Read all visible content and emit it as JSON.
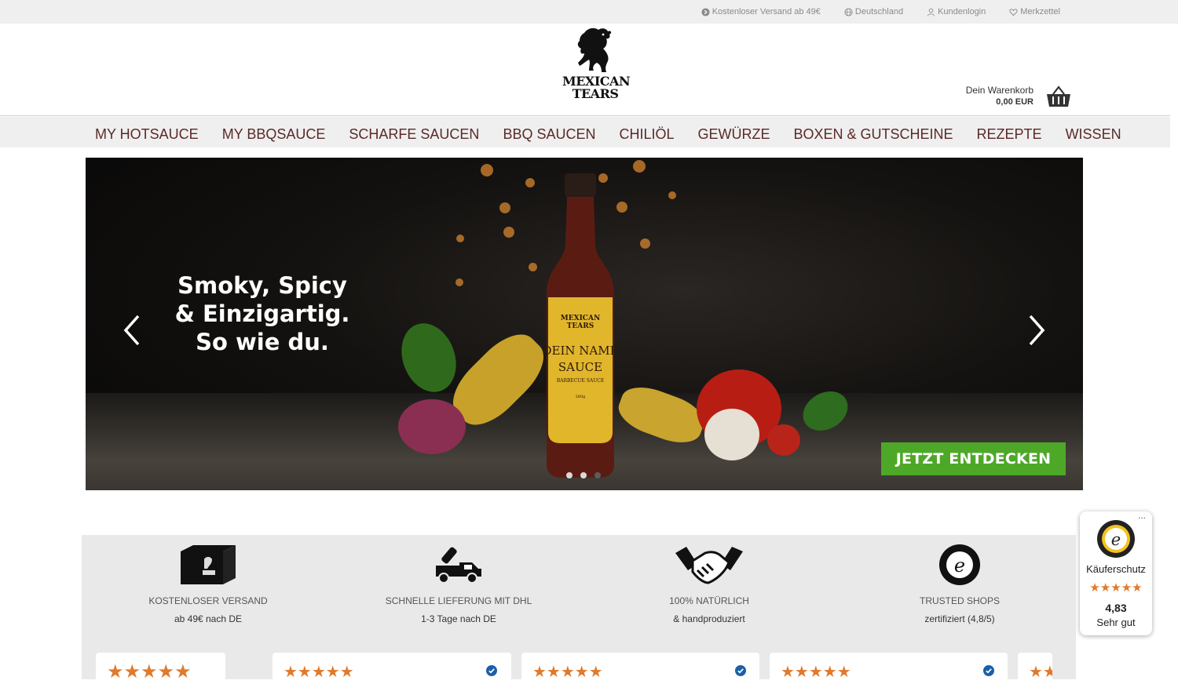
{
  "topbar": {
    "shipping": "Kostenloser Versand ab 49€",
    "country": "Deutschland",
    "login": "Kundenlogin",
    "wishlist": "Merkzettel"
  },
  "header": {
    "logo_line1": "MEXICAN",
    "logo_line2": "TEARS",
    "cart_label": "Dein Warenkorb",
    "cart_amount": "0,00 EUR"
  },
  "nav": {
    "items": [
      {
        "label": "MY HOTSAUCE"
      },
      {
        "label": "MY BBQSAUCE"
      },
      {
        "label": "SCHARFE SAUCEN"
      },
      {
        "label": "BBQ SAUCEN"
      },
      {
        "label": "CHILIÖL"
      },
      {
        "label": "GEWÜRZE"
      },
      {
        "label": "BOXEN & GUTSCHEINE"
      },
      {
        "label": "REZEPTE"
      },
      {
        "label": "WISSEN"
      }
    ]
  },
  "hero": {
    "headline_line1": "Smoky, Spicy",
    "headline_line2": "& Einzigartig.",
    "headline_line3": "So wie du.",
    "cta": "JETZT ENTDECKEN",
    "bottle_brand_1": "MEXICAN",
    "bottle_brand_2": "TEARS",
    "bottle_name_1": "DEIN NAME",
    "bottle_name_2": "SAUCE",
    "bottle_type": "BARBECUE SAUCE",
    "bottle_weight": "280g",
    "slides": 3,
    "active_slide": 1
  },
  "features": [
    {
      "title": "KOSTENLOSER VERSAND",
      "sub": "ab 49€ nach DE",
      "icon": "box-icon"
    },
    {
      "title": "SCHNELLE LIEFERUNG MIT DHL",
      "sub": "1-3 Tage nach DE",
      "icon": "truck-icon"
    },
    {
      "title": "100% NATÜRLICH",
      "sub": "& handproduziert",
      "icon": "handshake-icon"
    },
    {
      "title": "TRUSTED SHOPS",
      "sub": "zertifiziert (4,8/5)",
      "icon": "trusted-shops-seal-icon"
    }
  ],
  "reviews": {
    "stars": "★★★★★",
    "rating": 5
  },
  "trusted_badge": {
    "label": "Käuferschutz",
    "stars": "★★★★★",
    "score": "4,83",
    "grade": "Sehr gut",
    "more": "..."
  },
  "colors": {
    "nav_text": "#5a2a28",
    "cta": "#4ea828",
    "star": "#e07a2c",
    "topbar_bg": "#efefef",
    "features_bg": "#e9e9e9"
  }
}
